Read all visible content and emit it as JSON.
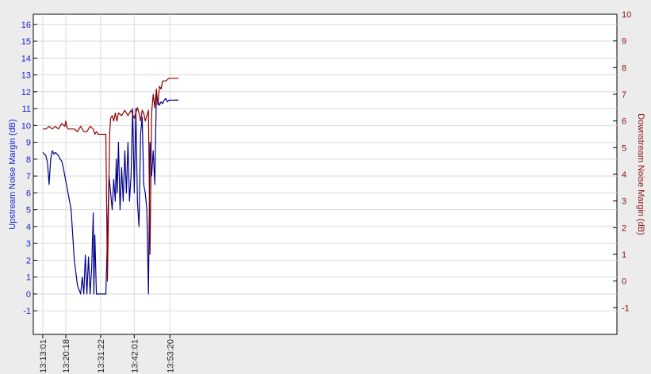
{
  "chart_data": {
    "type": "line",
    "xlabel": "",
    "x_tick_labels": [
      "13:13:01",
      "13:20:18",
      "13:31:22",
      "13:42:01",
      "13:53:20"
    ],
    "x_tick_minutes": [
      0,
      7.3,
      18.35,
      29.0,
      40.3
    ],
    "xlim_minutes": [
      -3.0,
      182.0
    ],
    "left_axis": {
      "label": "Upstream Noise Margin (dB)",
      "ylim": [
        -2.4,
        16.6
      ],
      "ticks": [
        -1,
        0,
        1,
        2,
        3,
        4,
        5,
        6,
        7,
        8,
        9,
        10,
        11,
        12,
        13,
        14,
        15,
        16
      ],
      "color": "#1a1ad6"
    },
    "right_axis": {
      "label": "Downstream Noise Margin (dB)",
      "ylim": [
        -2.0,
        10.0
      ],
      "ticks": [
        -1,
        0,
        1,
        2,
        3,
        4,
        5,
        6,
        7,
        8,
        9,
        10
      ],
      "color": "#8b1010"
    },
    "grid": true,
    "series": [
      {
        "axis": "left",
        "color": "#00008b",
        "x": [
          0,
          1,
          1.5,
          2,
          2.5,
          3,
          3.5,
          4,
          5,
          5.5,
          6,
          6.5,
          7,
          7.5,
          8,
          9,
          10,
          11,
          12,
          12.5,
          13,
          13.5,
          14,
          14.5,
          15,
          15.5,
          16,
          16.2,
          16.5,
          17,
          17.3,
          17.6,
          18,
          18.3,
          18.6,
          19,
          20,
          21,
          22,
          22.5,
          23,
          23.3,
          23.6,
          24,
          24.5,
          25,
          25.5,
          26,
          26.5,
          27,
          27.5,
          28,
          28.5,
          29,
          29.5,
          30,
          30.5,
          31,
          31.5,
          32,
          32.5,
          33,
          33.5,
          34,
          34.5,
          35,
          35.5,
          36,
          36.5,
          37,
          37.5,
          38,
          38.5,
          39,
          39.5,
          40,
          41,
          42,
          43
        ],
        "values": [
          8.4,
          8.2,
          7.8,
          6.5,
          8.0,
          8.5,
          8.3,
          8.4,
          8.2,
          8.0,
          7.9,
          7.5,
          7.0,
          6.5,
          6.0,
          5.0,
          2.0,
          0.5,
          0.0,
          1.0,
          0.0,
          2.3,
          0.0,
          2.2,
          0.0,
          1.5,
          4.8,
          0.0,
          3.5,
          0.0,
          0.0,
          0.0,
          0.0,
          0.0,
          0.0,
          0.0,
          0.0,
          7.0,
          5.0,
          6.8,
          5.5,
          8.0,
          6.0,
          9.0,
          5.0,
          7.5,
          5.5,
          8.5,
          6.0,
          9.0,
          5.5,
          7.0,
          11.0,
          6.0,
          11.0,
          5.5,
          4.0,
          9.5,
          10.5,
          6.5,
          6.0,
          5.0,
          0.0,
          9.0,
          7.0,
          8.5,
          6.5,
          11.8,
          11.5,
          11.2,
          11.4,
          11.3,
          11.5,
          11.6,
          11.4,
          11.5,
          11.5,
          11.5,
          11.5
        ]
      },
      {
        "axis": "right",
        "color": "#8b0000",
        "x": [
          0,
          1,
          2,
          3,
          4,
          5,
          6,
          7,
          7.3,
          7.6,
          8,
          9,
          10,
          11,
          12,
          13,
          14,
          15,
          16,
          16.5,
          17,
          17.5,
          18,
          19,
          20,
          20.5,
          21,
          21.2,
          21.5,
          22,
          22.5,
          23,
          23.5,
          24,
          25,
          26,
          27,
          28,
          29,
          30,
          30.5,
          31,
          31.5,
          32,
          32.5,
          33,
          33.5,
          34,
          34.5,
          35,
          35.5,
          36,
          36.5,
          37,
          37.5,
          38,
          39,
          40,
          41,
          42,
          43
        ],
        "values": [
          5.7,
          5.7,
          5.8,
          5.7,
          5.8,
          5.7,
          5.9,
          5.8,
          6.0,
          5.8,
          5.7,
          5.7,
          5.7,
          5.6,
          5.8,
          5.6,
          5.6,
          5.8,
          5.7,
          5.5,
          5.6,
          5.5,
          5.5,
          5.5,
          5.5,
          0.0,
          4.0,
          5.5,
          6.1,
          6.2,
          6.0,
          6.3,
          6.0,
          6.3,
          6.2,
          6.4,
          6.2,
          6.4,
          6.1,
          6.5,
          6.3,
          6.0,
          6.4,
          6.3,
          6.0,
          6.2,
          6.4,
          1.0,
          6.3,
          7.0,
          6.5,
          7.2,
          6.6,
          7.3,
          7.2,
          7.5,
          7.5,
          7.6,
          7.6,
          7.6,
          7.6
        ]
      }
    ]
  },
  "colors": {
    "background": "#ececec",
    "plot_bg": "#ffffff",
    "grid": "#d9d9d9",
    "left_axis_text": "#1a1ad6",
    "right_axis_text": "#8b1010"
  }
}
